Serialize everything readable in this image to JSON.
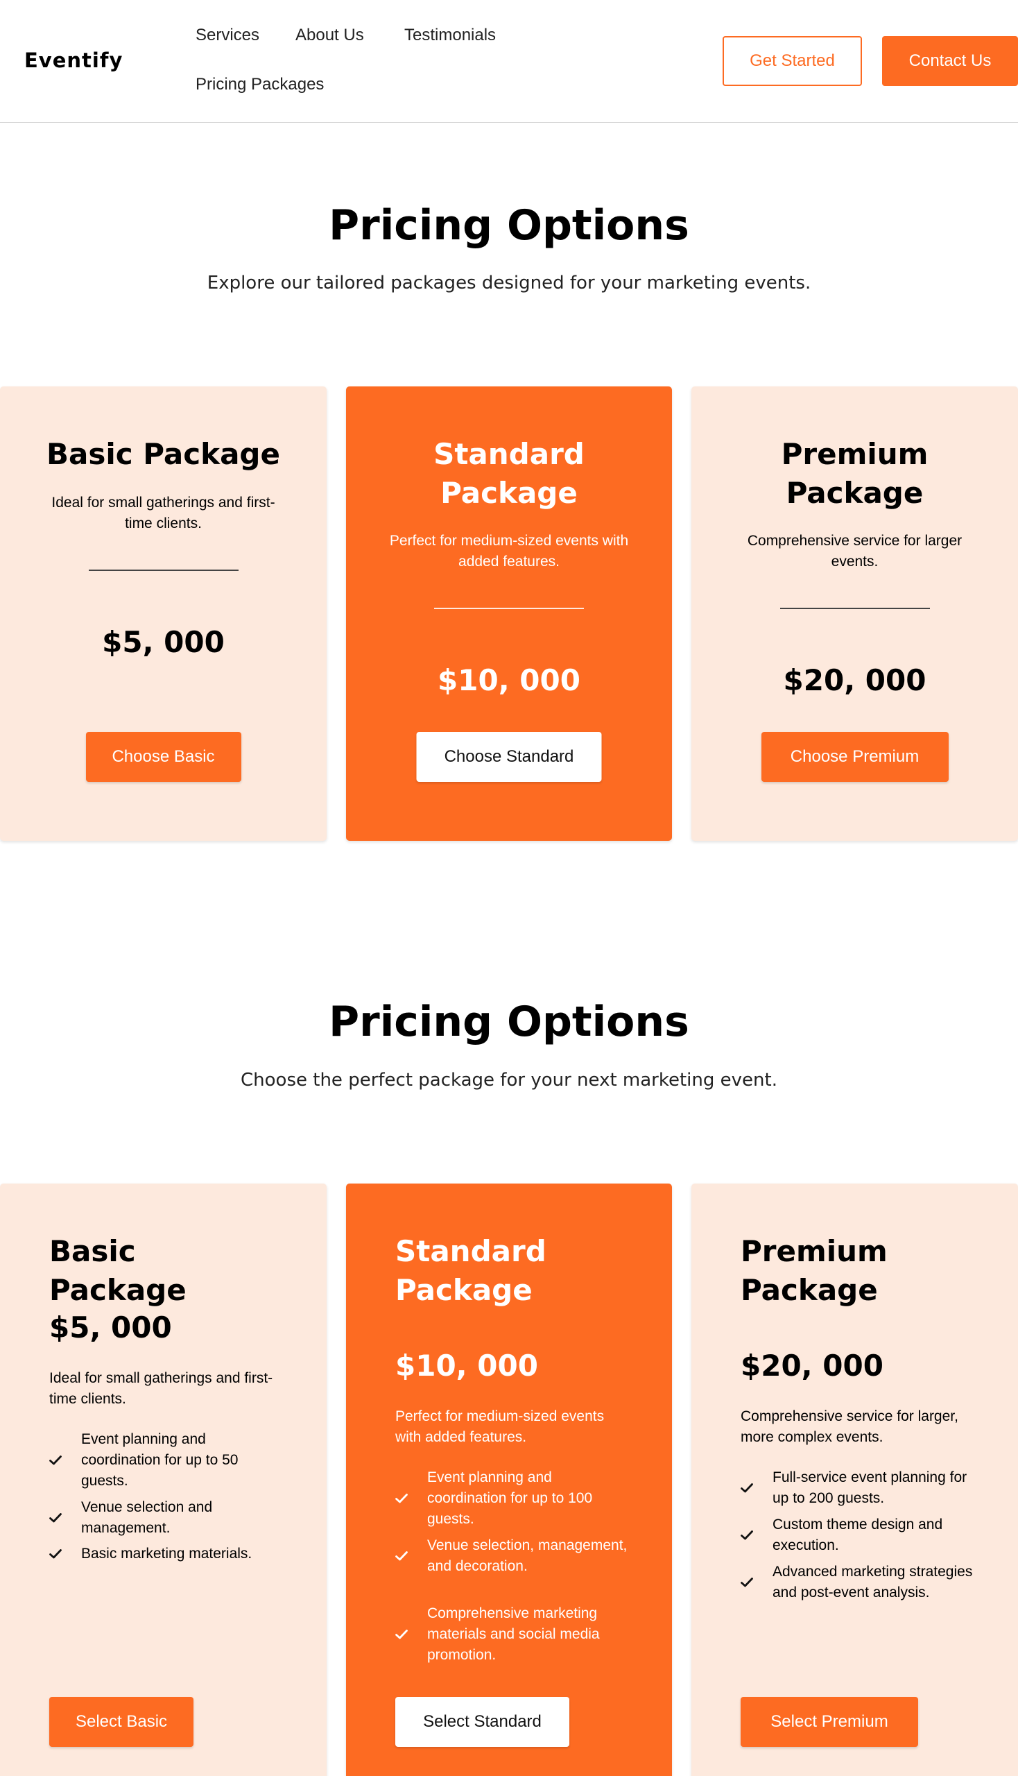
{
  "brand": {
    "name": "Eventify",
    "accent_color": "#fd6b22",
    "light_card_color": "#fde9dd"
  },
  "nav": {
    "items": [
      {
        "label": "Services"
      },
      {
        "label": "About Us"
      },
      {
        "label": "Testimonials"
      },
      {
        "label": "Pricing Packages"
      }
    ],
    "get_started": "Get Started",
    "contact_us": "Contact Us"
  },
  "pricing1": {
    "title": "Pricing Options",
    "subtitle": "Explore our tailored packages designed for your marketing events.",
    "cards": [
      {
        "title": "Basic Package",
        "description": "Ideal for small gatherings and first-time clients.",
        "price": "$5, 000",
        "button": "Choose Basic"
      },
      {
        "title": "Standard Package",
        "description": "Perfect for medium-sized events with added features.",
        "price": "$10, 000",
        "button": "Choose Standard"
      },
      {
        "title": "Premium Package",
        "description": "Comprehensive service for larger events.",
        "price": "$20, 000",
        "button": "Choose Premium"
      }
    ]
  },
  "pricing2": {
    "title": "Pricing Options",
    "subtitle": "Choose the perfect package for your next marketing event.",
    "cards": [
      {
        "title": "Basic Package",
        "price": "$5, 000",
        "description": "Ideal for small gatherings and first-time clients.",
        "features": [
          "Event planning and coordination for up to 50 guests.",
          "Venue selection and management.",
          "Basic marketing materials."
        ],
        "button": "Select Basic"
      },
      {
        "title": "Standard Package",
        "price": "$10, 000",
        "description": "Perfect for medium-sized events with added features.",
        "features": [
          "Event planning and coordination for up to 100 guests.",
          "Venue selection, management, and decoration.",
          "Comprehensive marketing materials and social media promotion."
        ],
        "button": "Select Standard"
      },
      {
        "title": "Premium Package",
        "price": "$20, 000",
        "description": "Comprehensive service for larger, more complex events.",
        "features": [
          "Full-service event planning for up to 200 guests.",
          "Custom theme design and execution.",
          "Advanced marketing strategies and post-event analysis."
        ],
        "button": "Select Premium"
      }
    ]
  }
}
